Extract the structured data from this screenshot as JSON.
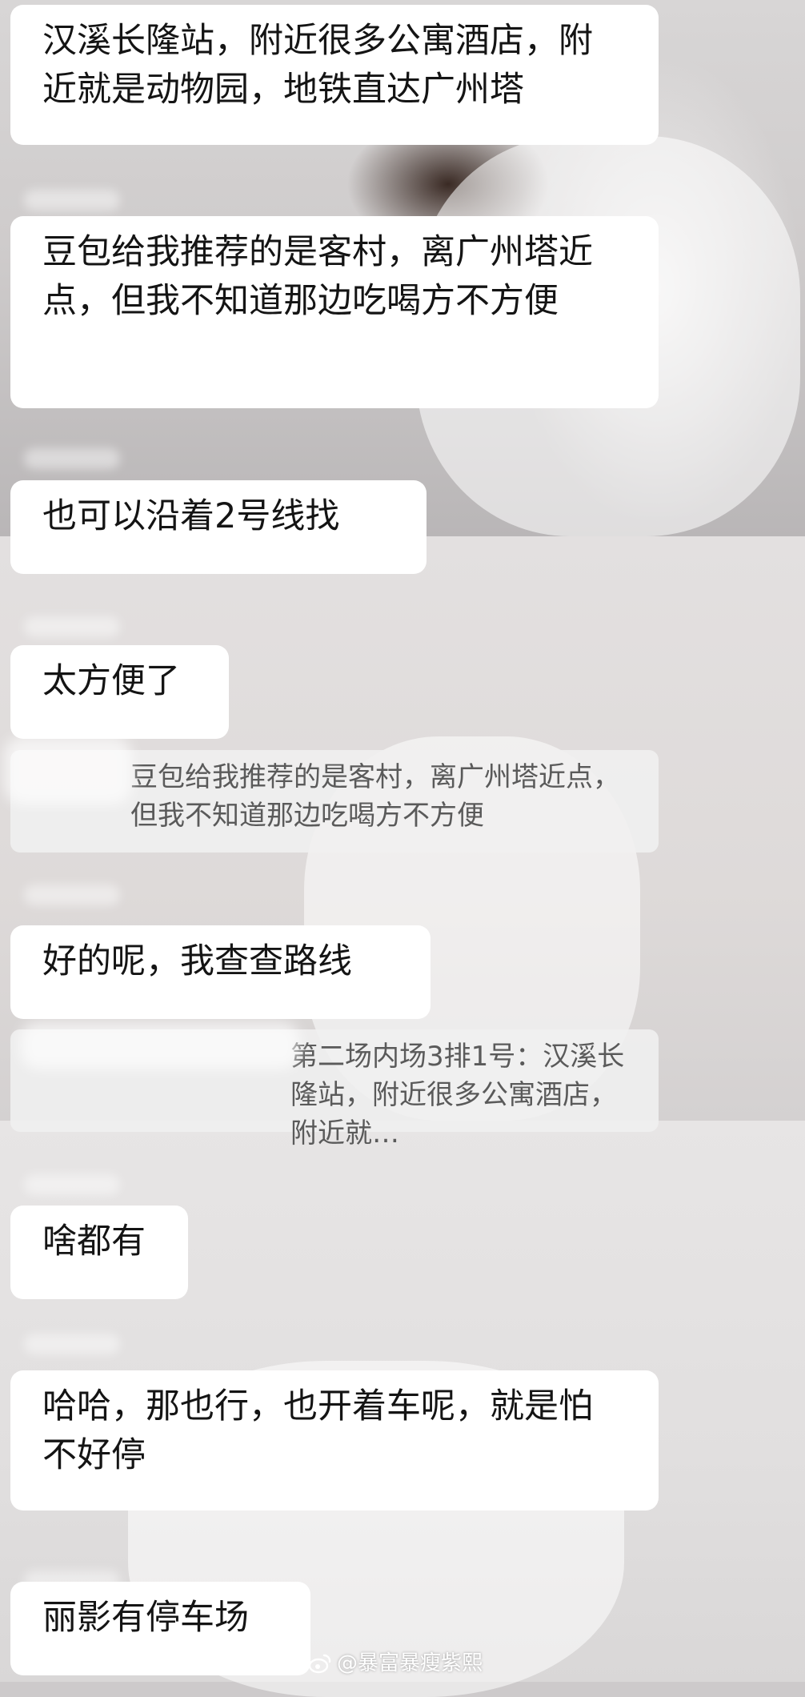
{
  "messages": [
    {
      "text": "汉溪长隆站，附近很多公寓酒店，附近就是动物园，地铁直达广州塔"
    },
    {
      "text": "豆包给我推荐的是客村，离广州塔近点，但我不知道那边吃喝方不方便"
    },
    {
      "text": "也可以沿着2号线找"
    },
    {
      "text": "太方便了"
    },
    {
      "text": "好的呢，我查查路线"
    },
    {
      "text": "啥都有"
    },
    {
      "text": "哈哈，那也行，也开着车呢，就是怕不好停"
    },
    {
      "text": "丽影有停车场"
    }
  ],
  "quotes": [
    {
      "text": "豆包给我推荐的是客村，离广州塔近点，但我不知道那边吃喝方不方便"
    },
    {
      "text": "第二场内场3排1号：汉溪长隆站，附近很多公寓酒店，附近就…"
    }
  ],
  "watermark": {
    "text": "@暴富暴瘦紫熙",
    "icon": "weibo-icon"
  }
}
